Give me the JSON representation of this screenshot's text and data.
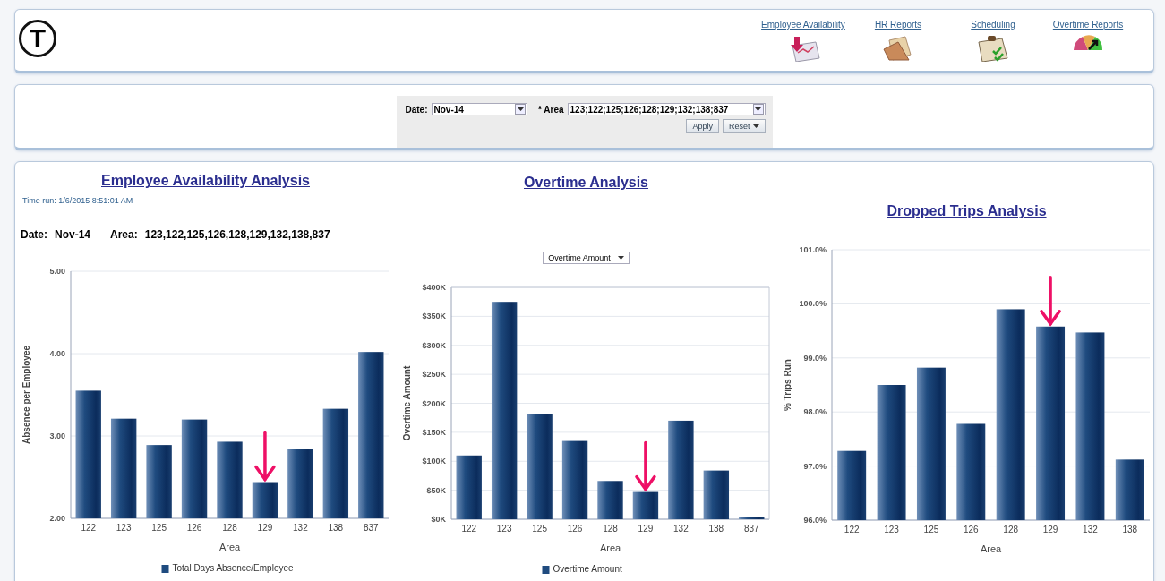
{
  "header": {
    "logo_text": "T",
    "links": [
      {
        "label": "Employee Availability"
      },
      {
        "label": "HR Reports"
      },
      {
        "label": "Scheduling"
      },
      {
        "label": "Overtime Reports"
      }
    ]
  },
  "filters": {
    "date": {
      "label": "Date:",
      "value": "Nov-14"
    },
    "area": {
      "label": "* Area",
      "value": "123;122;125;126;128;129;132;138;837"
    },
    "buttons": [
      {
        "label": "Apply",
        "dropdown": false
      },
      {
        "label": "Reset",
        "dropdown": true
      }
    ]
  },
  "panels": [
    {
      "title": "Employee Availability Analysis",
      "time_run": "Time run: 1/6/2015 8:51:01 AM",
      "date_label": "Date:",
      "date_value": "Nov-14",
      "area_label": "Area:",
      "area_value": "123,122,125,126,128,129,132,138,837",
      "chart_data": {
        "type": "bar",
        "xlabel": "Area",
        "ylabel": "Absence per Employee",
        "categories": [
          "122",
          "123",
          "125",
          "126",
          "128",
          "129",
          "132",
          "138",
          "837"
        ],
        "series": [
          {
            "name": "Total Days Absence/Employee",
            "color": "#1f4b7f",
            "values": [
              3.55,
              3.21,
              2.89,
              3.2,
              2.93,
              2.44,
              2.84,
              3.33,
              4.02
            ]
          }
        ],
        "ylim": [
          2,
          5
        ],
        "grid": true,
        "yticks": [
          {
            "value": 2,
            "label": "2.00"
          },
          {
            "value": 3,
            "label": "3.00"
          },
          {
            "value": 4,
            "label": "4.00"
          },
          {
            "value": 5,
            "label": "5.00"
          }
        ]
      },
      "bar_arrows": [
        false,
        false,
        false,
        false,
        false,
        true,
        false,
        false,
        false
      ]
    },
    {
      "title": "Overtime Analysis",
      "selector": "Overtime Amount",
      "chart_data": {
        "type": "bar",
        "xlabel": "Area",
        "ylabel": "Overtime Amount",
        "categories": [
          "122",
          "123",
          "125",
          "126",
          "128",
          "129",
          "132",
          "138",
          "837"
        ],
        "series": [
          {
            "name": "Overtime Amount",
            "color": "#1f4b7f",
            "values": [
              110000,
              375000,
              181000,
              135000,
              66000,
              47000,
              170000,
              84000,
              4000
            ]
          }
        ],
        "ylim": [
          0,
          400000
        ],
        "yticks": [
          {
            "value": 0,
            "label": "$0K"
          },
          {
            "value": 50000,
            "label": "$50K"
          },
          {
            "value": 100000,
            "label": "$100K"
          },
          {
            "value": 150000,
            "label": "$150K"
          },
          {
            "value": 200000,
            "label": "$200K"
          },
          {
            "value": 250000,
            "label": "$250K"
          },
          {
            "value": 300000,
            "label": "$300K"
          },
          {
            "value": 350000,
            "label": "$350K"
          },
          {
            "value": 400000,
            "label": "$400K"
          }
        ],
        "grid": true
      },
      "bar_arrows": [
        false,
        false,
        false,
        false,
        false,
        true,
        false,
        false,
        false
      ]
    },
    {
      "title": "Dropped Trips Analysis",
      "chart_data": {
        "type": "bar",
        "xlabel": "Area",
        "ylabel": "% Trips Run",
        "categories": [
          "122",
          "123",
          "125",
          "126",
          "128",
          "129",
          "132",
          "138"
        ],
        "series": [
          {
            "color": "#1f4b7f",
            "values": [
              97.28,
              98.5,
              98.82,
              97.78,
              99.9,
              99.58,
              99.47,
              97.12
            ]
          }
        ],
        "ylim": [
          96,
          101
        ],
        "yticks": [
          {
            "value": 96,
            "label": "96.0%"
          },
          {
            "value": 97,
            "label": "97.0%"
          },
          {
            "value": 98,
            "label": "98.0%"
          },
          {
            "value": 99,
            "label": "99.0%"
          },
          {
            "value": 100,
            "label": "100.0%"
          },
          {
            "value": 101,
            "label": "101.0%"
          }
        ],
        "grid": true
      },
      "bar_arrows": [
        false,
        false,
        false,
        false,
        false,
        true,
        false,
        false
      ]
    }
  ]
}
